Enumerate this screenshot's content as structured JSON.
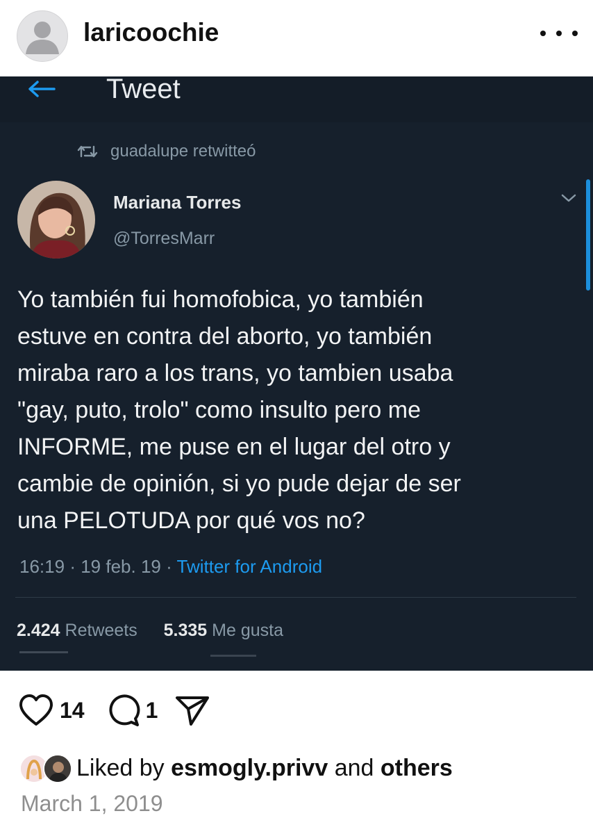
{
  "post": {
    "username": "laricoochie",
    "avatar_icon": "default-profile-icon",
    "more_icon": "more-horizontal-icon"
  },
  "tweet": {
    "header_title": "Tweet",
    "back_icon": "back-arrow-icon",
    "retweeted_by": "guadalupe retwitteó",
    "author_name": "Mariana Torres",
    "author_handle": "@TorresMarr",
    "body": "Yo también fui homofobica, yo también\nestuve en contra del aborto, yo también\nmiraba raro a los trans, yo tambien usaba\n\"gay, puto, trolo\" como insulto pero me\nINFORME, me puse en el lugar del otro y\ncambie de opinión, si yo pude dejar de ser\nuna PELOTUDA por qué vos no?",
    "time": "16:19",
    "date": "19 feb. 19",
    "source": "Twitter for Android",
    "retweets_count": "2.424",
    "retweets_label": "Retweets",
    "likes_count": "5.335",
    "likes_label": "Me gusta",
    "accent_color": "#1d9bf0"
  },
  "actions": {
    "likes_count": "14",
    "comments_count": "1",
    "like_icon": "heart-icon",
    "comment_icon": "comment-icon",
    "share_icon": "send-icon"
  },
  "liked_by": {
    "prefix": "Liked by",
    "user": "esmogly.privv",
    "conjunction": "and",
    "others": "others"
  },
  "post_date": "March 1, 2019"
}
